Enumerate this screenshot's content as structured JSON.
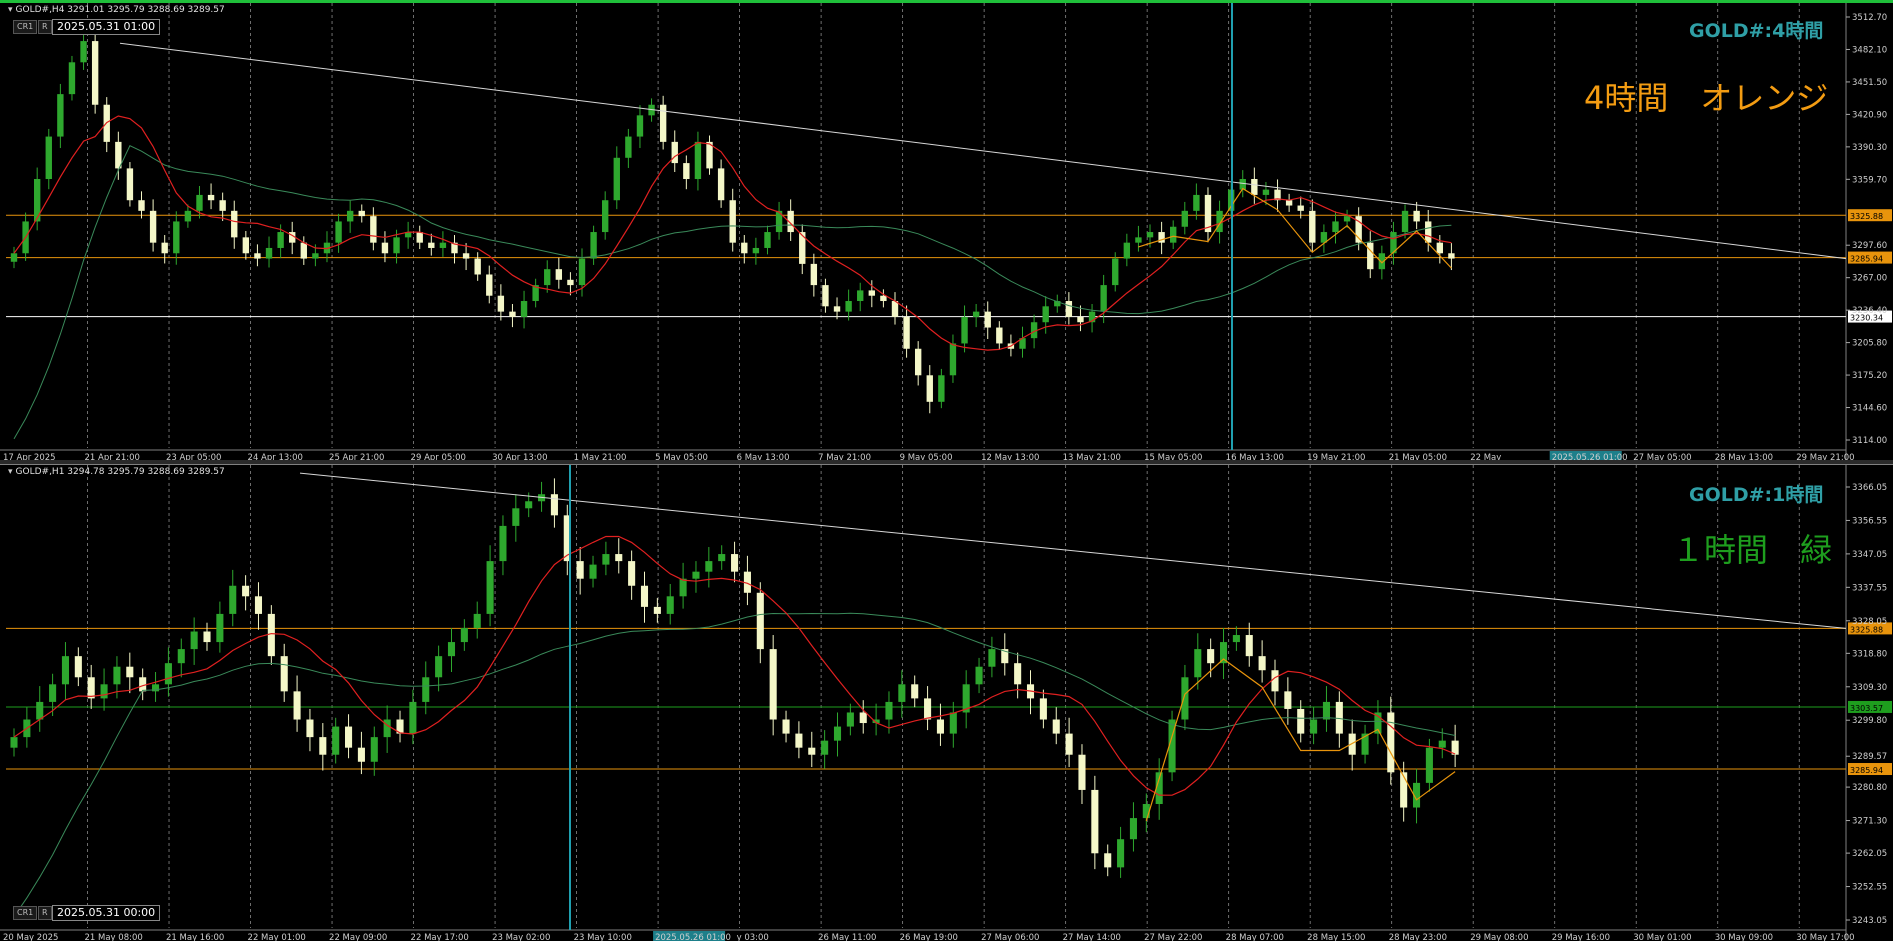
{
  "window": {
    "colors": {
      "background": "#000000",
      "bull": "#f4f7c8",
      "bear": "#2ea82e",
      "ma_fast": "#e02020",
      "ma_slow": "#3a8a5a",
      "trend": "#d8d8d8",
      "orange": "#e8940c",
      "teal": "#20a0b0",
      "grid": "#8a8a8a"
    }
  },
  "panels": [
    {
      "id": "h4",
      "header": "GOLD#,H4  3291.01 3295.79 3288.69 3289.57",
      "tag_cr1": "CR1",
      "tag_r": "R",
      "date_box": "2025.05.31 01:00",
      "label_tf": "GOLD#:4時間",
      "label_note": "4時間　オレンジ",
      "label_note_color": "#f39c12",
      "price_ticks": [
        "3512.70",
        "3482.10",
        "3451.50",
        "3420.90",
        "3390.30",
        "3359.70",
        "3325.88",
        "3297.60",
        "3285.94",
        "3267.00",
        "3236.40",
        "3230.34",
        "3205.80",
        "3175.20",
        "3144.60",
        "3114.00"
      ],
      "time_labels": [
        "17 Apr 2025",
        "21 Apr 21:00",
        "23 Apr 05:00",
        "24 Apr 13:00",
        "25 Apr 21:00",
        "29 Apr 05:00",
        "30 Apr 13:00",
        "1 May 21:00",
        "5 May 05:00",
        "6 May 13:00",
        "7 May 21:00",
        "9 May 05:00",
        "12 May 13:00",
        "13 May 21:00",
        "15 May 05:00",
        "16 May 13:00",
        "19 May 21:00",
        "21 May 05:00",
        "22 May",
        "2025.05.26 01:00",
        "27 May 05:00",
        "28 May 13:00",
        "29 May 21:00"
      ],
      "hlines": [
        {
          "price": "3325.88",
          "color": "#e8940c"
        },
        {
          "price": "3285.94",
          "color": "#e8940c"
        },
        {
          "price": "3230.34",
          "color": "#ffffff"
        }
      ],
      "cursor_time": "2025.05.26 01:00"
    },
    {
      "id": "h1",
      "header": "GOLD#,H1  3294.78 3295.79 3288.69 3289.57",
      "tag_cr1": "CR1",
      "tag_r": "R",
      "date_box": "2025.05.31 00:00",
      "label_tf": "GOLD#:1時間",
      "label_note": "１時間　緑",
      "label_note_color": "#1e9e1e",
      "price_ticks": [
        "3366.05",
        "3356.55",
        "3347.05",
        "3337.55",
        "3328.05",
        "3325.88",
        "3318.80",
        "3309.30",
        "3303.57",
        "3299.80",
        "3289.57",
        "3285.94",
        "3280.80",
        "3271.30",
        "3262.05",
        "3252.55",
        "3243.05"
      ],
      "time_labels": [
        "20 May 2025",
        "21 May 08:00",
        "21 May 16:00",
        "22 May 01:00",
        "22 May 09:00",
        "22 May 17:00",
        "23 May 02:00",
        "23 May 10:00",
        "2025.05.26 01:00",
        "y 03:00",
        "26 May 11:00",
        "26 May 19:00",
        "27 May 06:00",
        "27 May 14:00",
        "27 May 22:00",
        "28 May 07:00",
        "28 May 15:00",
        "28 May 23:00",
        "29 May 08:00",
        "29 May 16:00",
        "30 May 01:00",
        "30 May 09:00",
        "30 May 17:00"
      ],
      "hlines": [
        {
          "price": "3325.88",
          "color": "#e8940c"
        },
        {
          "price": "3303.57",
          "color": "#1e9e1e"
        },
        {
          "price": "3285.94",
          "color": "#e8940c"
        }
      ],
      "cursor_time": "2025.05.26 01:00"
    }
  ],
  "chart_data": [
    {
      "type": "candlestick",
      "title": "GOLD#,H4",
      "ylim": [
        3114.0,
        3512.7
      ],
      "close_series": [
        3290,
        3320,
        3360,
        3400,
        3440,
        3470,
        3490,
        3430,
        3395,
        3370,
        3340,
        3330,
        3300,
        3290,
        3320,
        3330,
        3345,
        3340,
        3330,
        3305,
        3290,
        3285,
        3295,
        3310,
        3300,
        3285,
        3290,
        3300,
        3320,
        3330,
        3325,
        3300,
        3290,
        3305,
        3310,
        3300,
        3295,
        3300,
        3290,
        3285,
        3270,
        3250,
        3235,
        3230,
        3245,
        3260,
        3275,
        3265,
        3260,
        3285,
        3310,
        3340,
        3380,
        3400,
        3420,
        3430,
        3395,
        3375,
        3360,
        3395,
        3370,
        3340,
        3300,
        3290,
        3295,
        3310,
        3330,
        3310,
        3280,
        3260,
        3240,
        3235,
        3245,
        3255,
        3250,
        3245,
        3230,
        3200,
        3175,
        3150,
        3175,
        3205,
        3230,
        3235,
        3220,
        3205,
        3200,
        3210,
        3225,
        3240,
        3245,
        3230,
        3225,
        3235,
        3260,
        3285,
        3300,
        3305,
        3310,
        3300,
        3315,
        3330,
        3345,
        3310,
        3330,
        3350,
        3360,
        3345,
        3350,
        3340,
        3335,
        3330,
        3300,
        3310,
        3320,
        3325,
        3300,
        3275,
        3290,
        3310,
        3330,
        3320,
        3300,
        3290,
        3285
      ],
      "trendline": {
        "from": 3488,
        "to": 3285
      },
      "hlines": [
        3325.88,
        3285.94,
        3230.34
      ]
    },
    {
      "type": "candlestick",
      "title": "GOLD#,H1",
      "ylim": [
        3243.05,
        3366.05
      ],
      "close_series": [
        3295,
        3300,
        3305,
        3310,
        3318,
        3312,
        3306,
        3310,
        3315,
        3312,
        3308,
        3310,
        3316,
        3320,
        3325,
        3322,
        3330,
        3338,
        3335,
        3330,
        3318,
        3308,
        3300,
        3295,
        3290,
        3298,
        3292,
        3288,
        3295,
        3300,
        3296,
        3305,
        3312,
        3318,
        3322,
        3326,
        3330,
        3345,
        3355,
        3360,
        3362,
        3364,
        3358,
        3345,
        3340,
        3344,
        3347,
        3345,
        3338,
        3332,
        3330,
        3335,
        3340,
        3342,
        3345,
        3347,
        3342,
        3336,
        3320,
        3300,
        3296,
        3292,
        3290,
        3294,
        3298,
        3302,
        3299,
        3300,
        3305,
        3310,
        3306,
        3300,
        3296,
        3302,
        3310,
        3315,
        3320,
        3316,
        3310,
        3306,
        3300,
        3296,
        3290,
        3280,
        3262,
        3258,
        3266,
        3272,
        3276,
        3285,
        3300,
        3312,
        3320,
        3316,
        3322,
        3324,
        3318,
        3314,
        3308,
        3303,
        3296,
        3300,
        3305,
        3296,
        3290,
        3296,
        3302,
        3285,
        3275,
        3282,
        3292,
        3294,
        3290
      ],
      "trendline": {
        "from": 3370,
        "to": 3325.88
      },
      "hlines": [
        3325.88,
        3303.57,
        3285.94
      ]
    }
  ]
}
